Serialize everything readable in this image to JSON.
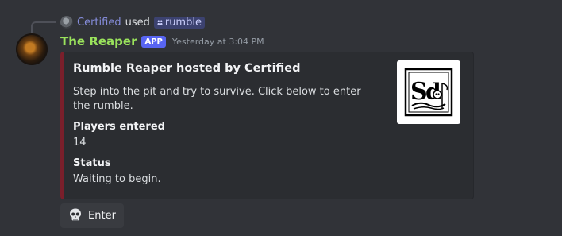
{
  "reply": {
    "username": "Certified",
    "used_text": "used",
    "command": "rumble"
  },
  "message": {
    "author": "The Reaper",
    "badge": "APP",
    "timestamp": "Yesterday at 3:04 PM",
    "author_color": "#9ae35c"
  },
  "embed": {
    "accent_color": "#7a1f2b",
    "title": "Rumble Reaper hosted by Certified",
    "description": "Step into the pit and try to survive. Click below to enter the rumble.",
    "thumbnail_icon": "reaper-logo-icon",
    "fields": [
      {
        "name": "Players entered",
        "value": "14"
      },
      {
        "name": "Status",
        "value": "Waiting to begin."
      }
    ]
  },
  "button": {
    "icon": "skull-icon",
    "label": "Enter"
  }
}
